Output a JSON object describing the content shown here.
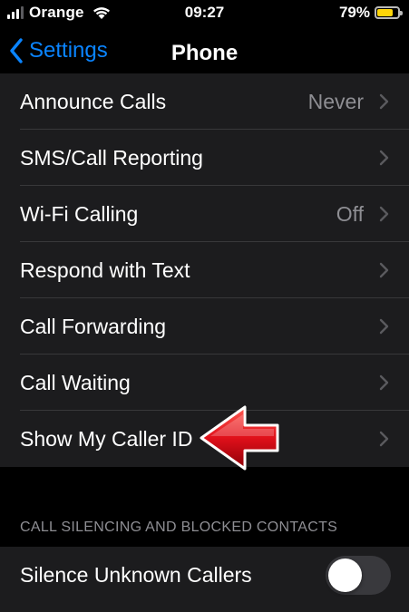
{
  "status_bar": {
    "carrier": "Orange",
    "time": "09:27",
    "battery_percent": "79%",
    "battery_level": 0.79,
    "signal_bars": 3,
    "signal_icon": "signal-bars-icon",
    "wifi_icon": "wifi-icon",
    "battery_icon": "battery-icon"
  },
  "nav": {
    "back_label": "Settings",
    "title": "Phone",
    "back_icon": "chevron-left-icon"
  },
  "rows": [
    {
      "label": "Announce Calls",
      "value": "Never"
    },
    {
      "label": "SMS/Call Reporting",
      "value": ""
    },
    {
      "label": "Wi-Fi Calling",
      "value": "Off"
    },
    {
      "label": "Respond with Text",
      "value": ""
    },
    {
      "label": "Call Forwarding",
      "value": ""
    },
    {
      "label": "Call Waiting",
      "value": ""
    },
    {
      "label": "Show My Caller ID",
      "value": ""
    }
  ],
  "section2": {
    "header": "CALL SILENCING AND BLOCKED CONTACTS",
    "rows": [
      {
        "label": "Silence Unknown Callers",
        "toggle_on": false
      }
    ]
  },
  "annotation": {
    "icon": "red-arrow-icon",
    "points_to": "Show My Caller ID"
  },
  "colors": {
    "accent": "#0a84ff",
    "cell_background": "#1c1c1e",
    "separator": "#38383a",
    "secondary_text": "#8e8e93",
    "chevron": "#5a5a5e",
    "battery_fill": "#ffd60a",
    "toggle_off": "#39393d",
    "arrow_red": "#e0101a"
  }
}
